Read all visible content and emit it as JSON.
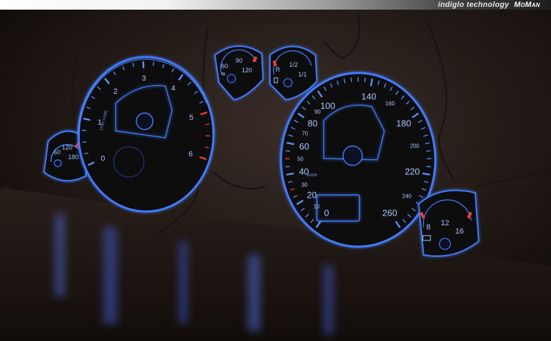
{
  "banner": {
    "tagline": "indiglo technology",
    "brand": "MoMan"
  },
  "gauges": {
    "tachometer": {
      "ticks": [
        "0",
        "1",
        "2",
        "3",
        "4",
        "5",
        "6"
      ],
      "units": "1/min x1000",
      "redline_from": 5
    },
    "speedometer": {
      "major_ticks": [
        "0",
        "20",
        "40",
        "60",
        "80",
        "100",
        "140",
        "180",
        "220",
        "260"
      ],
      "minor_ticks": [
        "10",
        "30",
        "50",
        "70",
        "90",
        "160",
        "200",
        "240"
      ],
      "units": "km/h"
    },
    "left_temp": {
      "ticks": [
        "60",
        "120",
        "180"
      ]
    },
    "coolant_temp": {
      "ticks": [
        "60",
        "90",
        "120"
      ]
    },
    "fuel": {
      "ticks": [
        "R",
        "1/2",
        "1/1"
      ]
    },
    "voltage": {
      "ticks": [
        "8",
        "12",
        "16"
      ]
    }
  },
  "colors": {
    "glow": "#3f7dff",
    "glow_light": "#a9c8ff",
    "redline": "#ff3b2a",
    "face": "#07080d",
    "wall": "#2e2420",
    "banner_text": "#e6e6e6"
  }
}
